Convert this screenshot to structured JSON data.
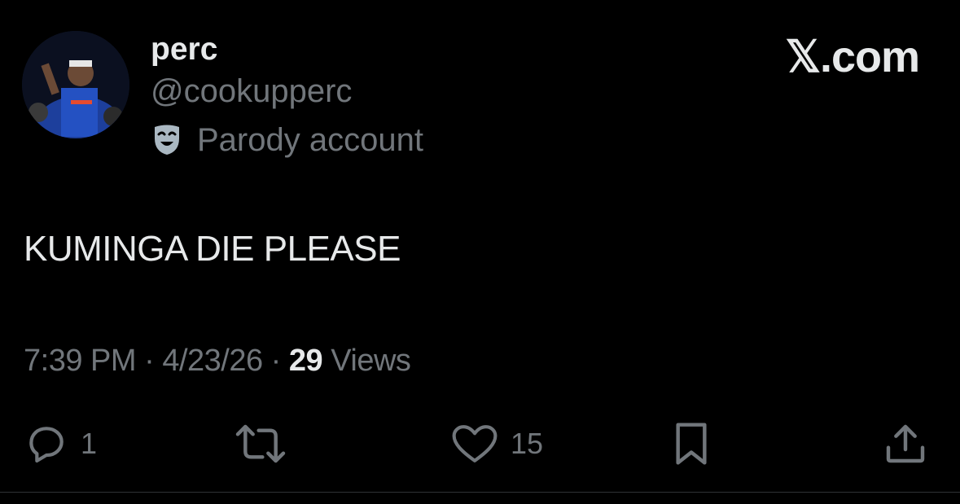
{
  "author": {
    "display_name": "perc",
    "handle": "@cookupperc",
    "label_icon": "theater-mask-icon",
    "label": "Parody account"
  },
  "brand": {
    "logo_text": "𝕏.com"
  },
  "tweet": {
    "text": "KUMINGA DIE PLEASE",
    "time": "7:39 PM",
    "separator": "·",
    "date": "4/23/26",
    "views_count": "29",
    "views_label": "Views"
  },
  "actions": {
    "reply": {
      "icon": "reply-icon",
      "count": "1"
    },
    "repost": {
      "icon": "repost-icon"
    },
    "like": {
      "icon": "heart-icon",
      "count": "15"
    },
    "bookmark": {
      "icon": "bookmark-icon"
    },
    "share": {
      "icon": "share-icon"
    }
  },
  "colors": {
    "background": "#000000",
    "primary_text": "#e7e9ea",
    "secondary_text": "#71767b"
  }
}
